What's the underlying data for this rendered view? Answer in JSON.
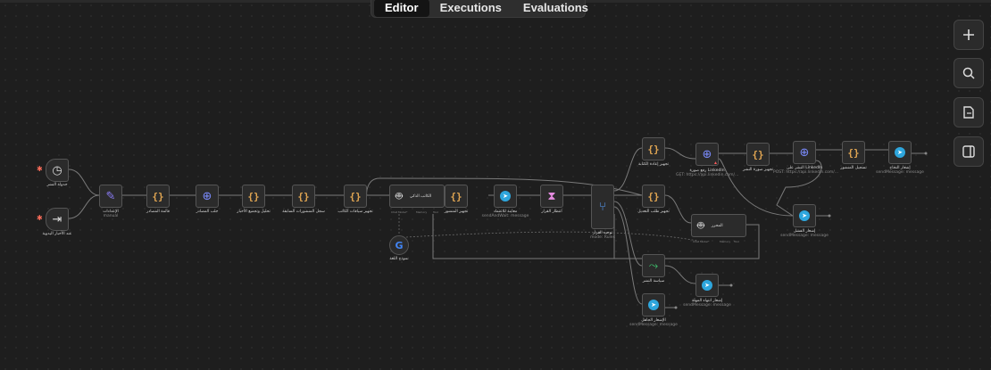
{
  "tabs": [
    "Editor",
    "Executions",
    "Evaluations"
  ],
  "side_buttons": [
    "plus-icon",
    "search-icon",
    "sticky-note-icon",
    "sidebar-toggle-icon"
  ],
  "nodes": {
    "n1": {
      "label": "جدولة النشر",
      "sub": ""
    },
    "n2": {
      "label": "عند الأخبار اليدوية",
      "sub": ""
    },
    "n3": {
      "label": "الإعدادات",
      "sub": "manual"
    },
    "n4": {
      "label": "قائمة المصادر",
      "sub": ""
    },
    "n5": {
      "label": "جلب المصادر",
      "sub": ""
    },
    "n6": {
      "label": "تحليل وتجميع الأخبار",
      "sub": ""
    },
    "n7": {
      "label": "سجل المنشورات السابقة",
      "sub": ""
    },
    "n8": {
      "label": "تجهيز سياقات الكاتب",
      "sub": ""
    },
    "n9": {
      "label": "الكاتب الذكي",
      "sub": ""
    },
    "n10": {
      "label": "تجهيز المنشور",
      "sub": ""
    },
    "n11": {
      "label": "معاينة للاعتماد",
      "sub": "sendAndWait: message"
    },
    "n12": {
      "label": "انتظار القرار",
      "sub": ""
    },
    "n13": {
      "label": "توجيه القرار",
      "sub": "mode: Rules"
    },
    "n14": {
      "label": "تجهيز إعادة الكتابة",
      "sub": ""
    },
    "n15": {
      "label": "تجهيز طلب التعديل",
      "sub": ""
    },
    "n16": {
      "label": "سياسة النشر",
      "sub": ""
    },
    "n17": {
      "label": "الإشعار الجاهل",
      "sub": "sendMessage: message"
    },
    "n18": {
      "label": "رفع صورة LinkedIn",
      "sub": "GET: https://api.linkedin.com/..."
    },
    "n19": {
      "label": "تجهيز صورة النشر",
      "sub": ""
    },
    "n20": {
      "label": "النشر على LinkedIn",
      "sub": "POST: https://api.linkedin.com/..."
    },
    "n21": {
      "label": "تسجيل المنشور",
      "sub": ""
    },
    "n22": {
      "label": "إشعار النجاح",
      "sub": "sendMessage: message"
    },
    "n23": {
      "label": "المحرر",
      "sub": ""
    },
    "n24": {
      "label": "إشعار الفشل",
      "sub": "sendMessage: message"
    },
    "n25": {
      "label": "إشعار انتهاء المهلة",
      "sub": "sendMessage: message"
    },
    "n26": {
      "label": "نموذج اللغة",
      "sub": ""
    }
  },
  "ports": {
    "chat_model": "Chat Model*",
    "memory": "Memory",
    "tool": "Tool",
    "model": "model*"
  }
}
